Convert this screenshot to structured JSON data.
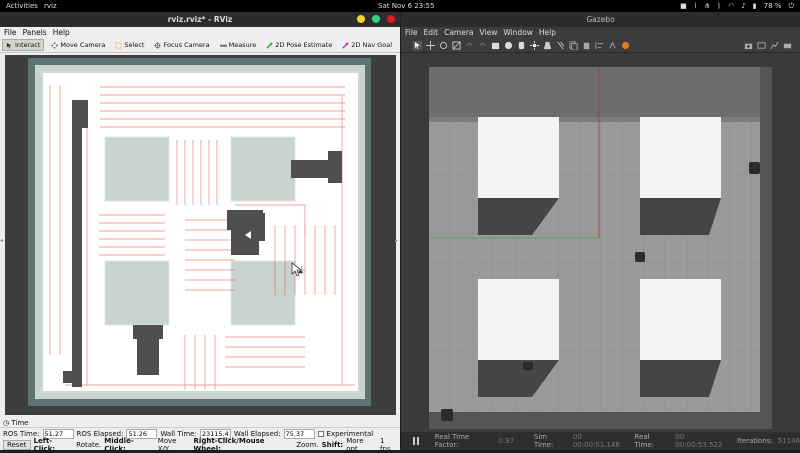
{
  "topbar": {
    "activities": "Activities",
    "app_name": "rviz",
    "clock": "Sat Nov 6  23:55",
    "battery": "78 %"
  },
  "rviz": {
    "title": "rviz.rviz* - RViz",
    "menu": [
      "File",
      "Panels",
      "Help"
    ],
    "tools": [
      {
        "label": "Interact",
        "icon": "interact-icon"
      },
      {
        "label": "Move Camera",
        "icon": "move-camera-icon"
      },
      {
        "label": "Select",
        "icon": "select-icon"
      },
      {
        "label": "Focus Camera",
        "icon": "focus-camera-icon"
      },
      {
        "label": "Measure",
        "icon": "measure-icon"
      },
      {
        "label": "2D Pose Estimate",
        "icon": "pose-estimate-icon"
      },
      {
        "label": "2D Nav Goal",
        "icon": "nav-goal-icon"
      }
    ],
    "time_panel": {
      "title": "Time",
      "ros_time_label": "ROS Time:",
      "ros_time": "51.27",
      "ros_elapsed_label": "ROS Elapsed:",
      "ros_elapsed": "51.26",
      "wall_time_label": "Wall Time:",
      "wall_time": "23115.45",
      "wall_elapsed_label": "Wall Elapsed:",
      "wall_elapsed": "75.37",
      "experimental_label": "Experimental"
    },
    "status": {
      "reset_label": "Reset",
      "left_click": "Left-Click:",
      "left_click_desc": "Rotate.",
      "middle_click": "Middle-Click:",
      "middle_click_desc": "Move X/Y.",
      "right_click": "Right-Click/Mouse Wheel:",
      "right_click_desc": "Zoom.",
      "shift": "Shift:",
      "shift_desc": "More opt",
      "fps": "1 fps"
    }
  },
  "gazebo": {
    "title": "Gazebo",
    "menu": [
      "File",
      "Edit",
      "Camera",
      "View",
      "Window",
      "Help"
    ],
    "status": {
      "rtf_label": "Real Time Factor:",
      "rtf": "0.97",
      "sim_time_label": "Sim Time:",
      "sim_time": "00 00:00:51.146",
      "real_time_label": "Real Time:",
      "real_time": "00 00:00:53.522",
      "iterations_label": "Iterations:",
      "iterations": "51146"
    }
  },
  "colors": {
    "map_free": "#ffffff",
    "map_unknown": "#c8d3cf",
    "map_border": "#5f7470",
    "obstacle": "#4f4f4f",
    "laser": "#e35a5a",
    "gz_floor": "#9a9a9a",
    "gz_box": "#f4f4f4"
  }
}
